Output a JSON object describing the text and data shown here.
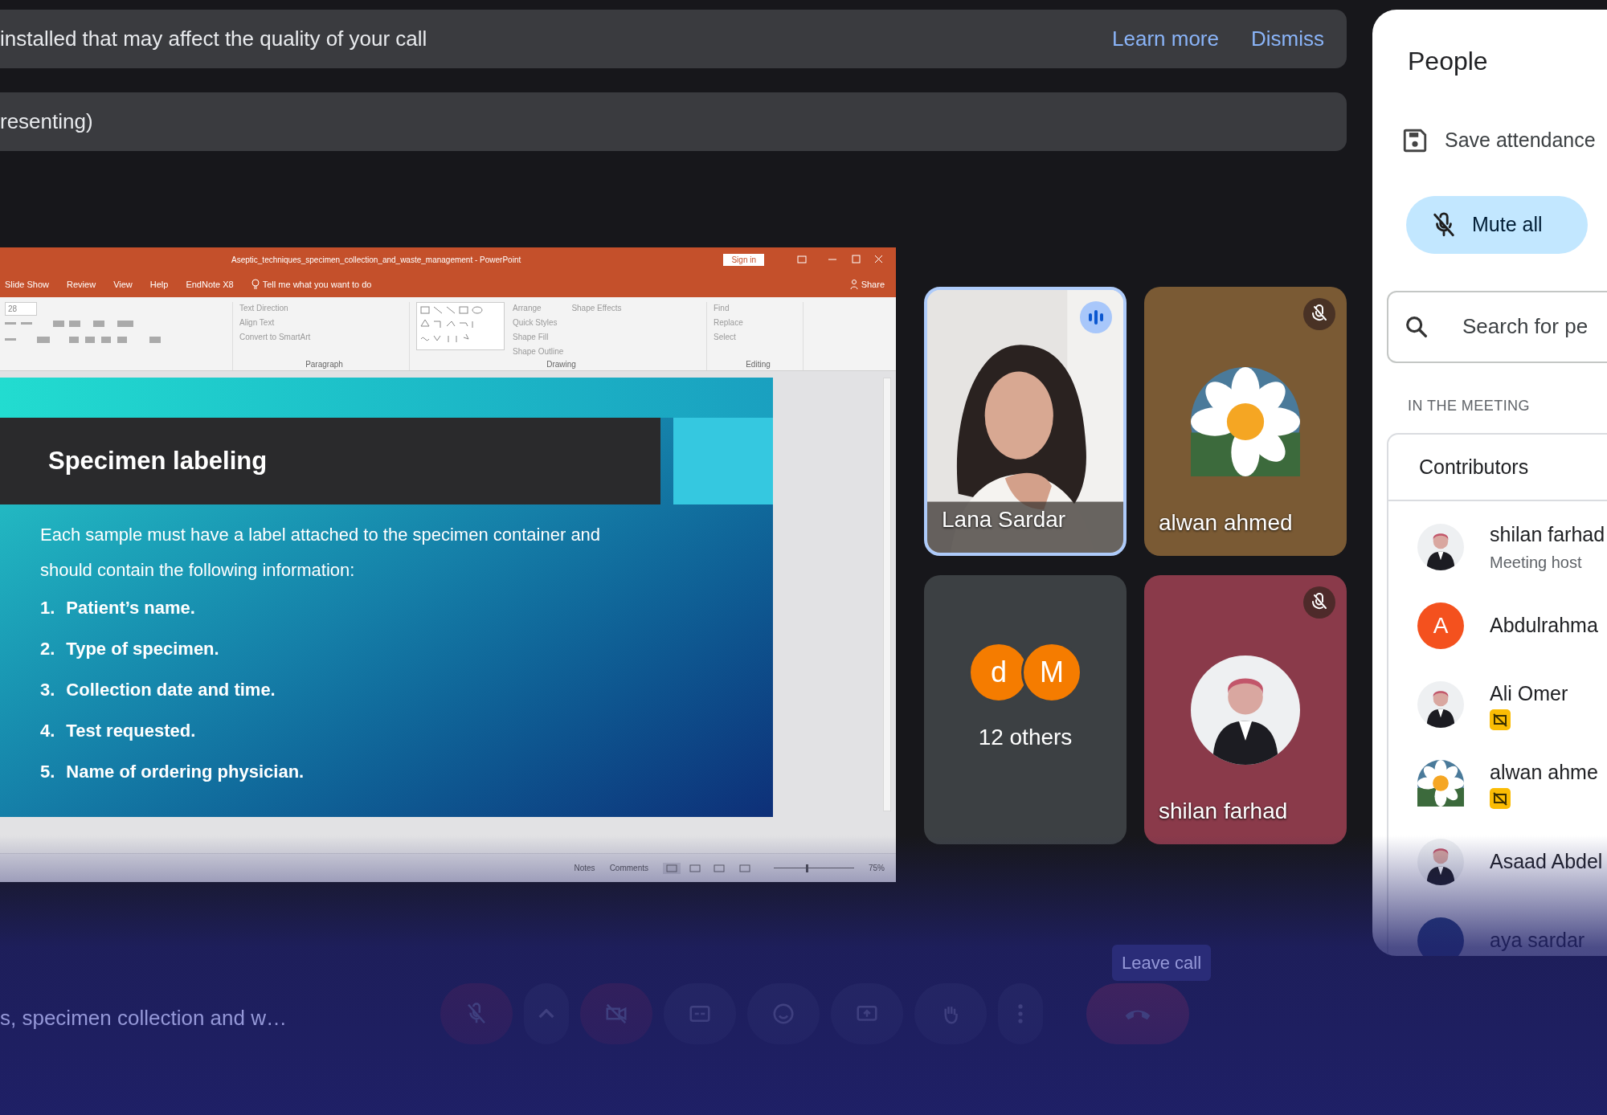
{
  "notification": {
    "message": "installed that may affect the quality of your call",
    "actions": [
      "Learn more",
      "Dismiss"
    ]
  },
  "presenting_banner": {
    "text": "resenting)"
  },
  "shared_window": {
    "title": "Aseptic_techniques_specimen_collection_and_waste_management  -  PowerPoint",
    "sign_in": "Sign in",
    "share": "Share",
    "tabs": [
      "Slide Show",
      "Review",
      "View",
      "Help",
      "EndNote X8"
    ],
    "tell_me": "Tell me what you want to do",
    "font_size": "28",
    "ribbon_groups": [
      {
        "label": "Paragraph",
        "items": [
          "Text Direction",
          "Align Text",
          "Convert to SmartArt"
        ]
      },
      {
        "label": "Drawing",
        "items": [
          "Arrange",
          "Quick Styles",
          "Shape Fill",
          "Shape Outline",
          "Shape Effects"
        ]
      },
      {
        "label": "Editing",
        "items": [
          "Find",
          "Replace",
          "Select"
        ]
      }
    ],
    "slide": {
      "title": "Specimen labeling",
      "intro": "Each sample must have a label attached to the specimen container and should contain the following information:",
      "items": [
        {
          "number": "1.",
          "text": "Patient’s name."
        },
        {
          "number": "2.",
          "text": "Type of specimen."
        },
        {
          "number": "3.",
          "text": "Collection date and time."
        },
        {
          "number": "4.",
          "text": "Test requested."
        },
        {
          "number": "5.",
          "text": "Name of ordering physician."
        }
      ]
    },
    "status_bar": {
      "notes": "Notes",
      "comments": "Comments",
      "zoom": "75%",
      "zoom_slider": {
        "level": 0.4
      }
    }
  },
  "tiles": [
    {
      "kind": "video",
      "name": "Lana Sardar",
      "speaking": true,
      "muted": false,
      "color": "#e6e4e2"
    },
    {
      "kind": "flower",
      "name": "alwan ahmed",
      "speaking": false,
      "muted": true,
      "color": "#7a5a34"
    },
    {
      "kind": "others",
      "label": "12 others",
      "avatars": [
        {
          "letter": "d",
          "color": "#f57c00"
        },
        {
          "letter": "M",
          "color": "#f57c00"
        }
      ]
    },
    {
      "kind": "portrait",
      "name": "shilan farhad",
      "speaking": false,
      "muted": true,
      "color": "#8a3a4a"
    }
  ],
  "people_panel": {
    "title": "People",
    "save_attendance": "Save attendance",
    "mute_all": "Mute all",
    "search": {
      "placeholder": "Search for pe"
    },
    "section": "IN THE MEETING",
    "group": "Contributors",
    "members": [
      {
        "name": "shilan farhad",
        "role": "Meeting host",
        "kind": "portrait",
        "badge": false
      },
      {
        "name": "Abdulrahma",
        "kind": "letter",
        "letter": "A",
        "color": "#f4511e",
        "badge": false
      },
      {
        "name": "Ali Omer",
        "kind": "portrait",
        "badge": true
      },
      {
        "name": "alwan ahme",
        "kind": "flower",
        "badge": true
      },
      {
        "name": "Asaad Abdel",
        "kind": "portrait",
        "badge": false
      },
      {
        "name": "aya sardar",
        "kind": "blank",
        "badge": false
      }
    ]
  },
  "call_bar": {
    "meeting_title": "s, specimen collection and w…",
    "leave_tooltip": "Leave call",
    "controls": [
      {
        "kind": "mic",
        "alert": true
      },
      {
        "kind": "caret",
        "alert": false
      },
      {
        "kind": "camera",
        "alert": true
      },
      {
        "kind": "captions",
        "alert": false
      },
      {
        "kind": "emoji",
        "alert": false
      },
      {
        "kind": "present",
        "alert": false
      },
      {
        "kind": "hand",
        "alert": false
      },
      {
        "kind": "more",
        "alert": false
      },
      {
        "kind": "leave",
        "alert": true
      }
    ]
  }
}
